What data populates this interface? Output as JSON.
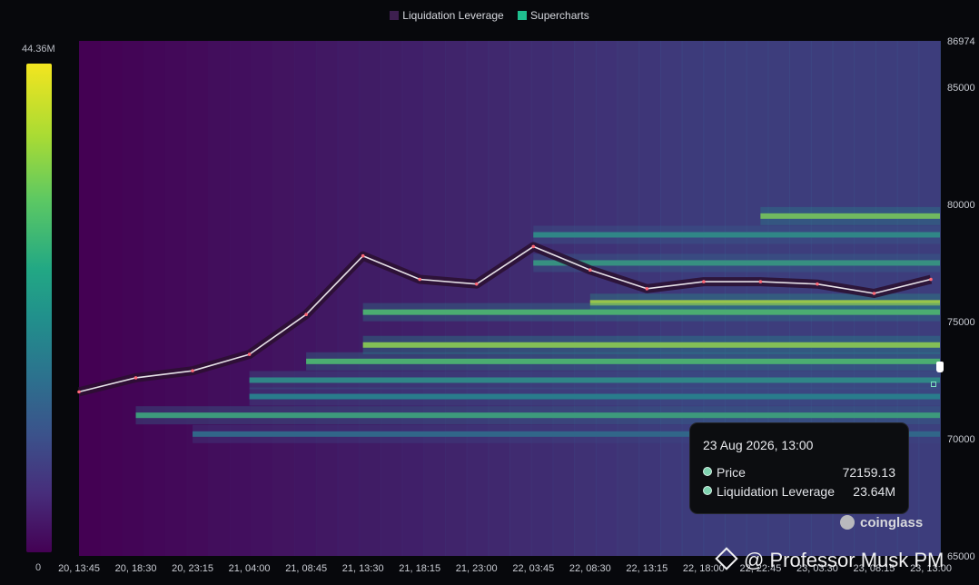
{
  "legend": [
    {
      "label": "Liquidation Leverage",
      "color": "#3d1f4f"
    },
    {
      "label": "Supercharts",
      "color": "#1fbf8f"
    }
  ],
  "colorbar": {
    "max_label": "44.36M",
    "min_label": "0"
  },
  "chart_data": {
    "type": "heatmap",
    "y_axis": {
      "ticks": [
        65000,
        70000,
        75000,
        80000,
        85000
      ],
      "top_label": "86974",
      "ylim": [
        65000,
        86974
      ]
    },
    "x_axis": {
      "ticks": [
        "20, 13:45",
        "20, 18:30",
        "20, 23:15",
        "21, 04:00",
        "21, 08:45",
        "21, 13:30",
        "21, 18:15",
        "21, 23:00",
        "22, 03:45",
        "22, 08:30",
        "22, 13:15",
        "22, 18:00",
        "22, 22:45",
        "23, 03:30",
        "23, 08:15",
        "23, 13:00"
      ]
    },
    "color_scale": {
      "min": 0,
      "max": 44.36,
      "unit": "M",
      "colors": [
        "#440154",
        "#3b528b",
        "#21908c",
        "#5cc863",
        "#f3e51f"
      ]
    },
    "heat_bands": [
      {
        "price": 79500,
        "from_index": 12,
        "intensity": 0.85
      },
      {
        "price": 78700,
        "from_index": 8,
        "intensity": 0.55
      },
      {
        "price": 77500,
        "from_index": 8,
        "intensity": 0.6
      },
      {
        "price": 75800,
        "from_index": 9,
        "intensity": 0.95
      },
      {
        "price": 75400,
        "from_index": 5,
        "intensity": 0.75
      },
      {
        "price": 74000,
        "from_index": 5,
        "intensity": 0.9
      },
      {
        "price": 73300,
        "from_index": 4,
        "intensity": 0.75
      },
      {
        "price": 72500,
        "from_index": 3,
        "intensity": 0.55
      },
      {
        "price": 71800,
        "from_index": 3,
        "intensity": 0.5
      },
      {
        "price": 71000,
        "from_index": 1,
        "intensity": 0.65
      },
      {
        "price": 70200,
        "from_index": 2,
        "intensity": 0.4
      }
    ],
    "price_series": [
      {
        "time": "20, 13:45",
        "price": 72000
      },
      {
        "time": "20, 18:30",
        "price": 72600
      },
      {
        "time": "20, 23:15",
        "price": 72900
      },
      {
        "time": "21, 04:00",
        "price": 73600
      },
      {
        "time": "21, 08:45",
        "price": 75300
      },
      {
        "time": "21, 13:30",
        "price": 77800
      },
      {
        "time": "21, 18:15",
        "price": 76800
      },
      {
        "time": "21, 23:00",
        "price": 76600
      },
      {
        "time": "22, 03:45",
        "price": 78200
      },
      {
        "time": "22, 08:30",
        "price": 77200
      },
      {
        "time": "22, 13:15",
        "price": 76400
      },
      {
        "time": "22, 18:00",
        "price": 76700
      },
      {
        "time": "22, 22:45",
        "price": 76700
      },
      {
        "time": "23, 03:30",
        "price": 76600
      },
      {
        "time": "23, 08:15",
        "price": 76200
      },
      {
        "time": "23, 13:00",
        "price": 76800
      }
    ]
  },
  "tooltip": {
    "date": "23 Aug 2026, 13:00",
    "price_label": "Price",
    "price_value": "72159.13",
    "lev_label": "Liquidation Leverage",
    "lev_value": "23.64M"
  },
  "brand": "coinglass",
  "watermark": "@ Professor Musk PM"
}
